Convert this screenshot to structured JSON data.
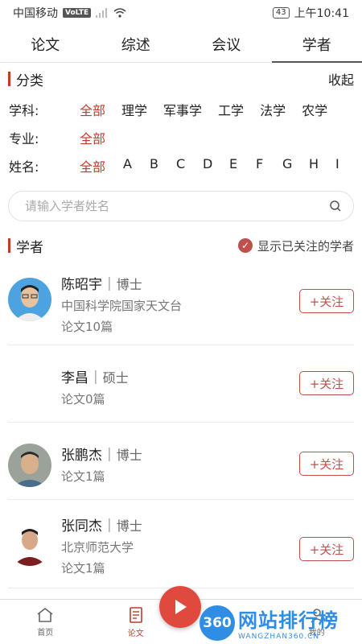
{
  "status": {
    "carrier": "中国移动",
    "volte": "VoLTE",
    "battery": "43",
    "time": "上午10:41"
  },
  "top_tabs": [
    "论文",
    "综述",
    "会议",
    "学者"
  ],
  "category": {
    "title": "分类",
    "collapse": "收起",
    "subject_label": "学科:",
    "subjects": [
      "全部",
      "理学",
      "军事学",
      "工学",
      "法学",
      "农学"
    ],
    "major_label": "专业:",
    "majors": [
      "全部"
    ],
    "name_label": "姓名:",
    "letters": [
      "全部",
      "A",
      "B",
      "C",
      "D",
      "E",
      "F",
      "G",
      "H",
      "I"
    ]
  },
  "search": {
    "placeholder": "请输入学者姓名"
  },
  "scholars_section": {
    "title": "学者",
    "show_followed": "显示已关注的学者"
  },
  "scholars": [
    {
      "name": "陈昭宇",
      "degree": "博士",
      "org": "中国科学院国家天文台",
      "papers": "论文10篇",
      "follow": "+关注",
      "has_avatar": true
    },
    {
      "name": "李昌",
      "degree": "硕士",
      "org": "",
      "papers": "论文0篇",
      "follow": "+关注",
      "has_avatar": false
    },
    {
      "name": "张鹏杰",
      "degree": "博士",
      "org": "",
      "papers": "论文1篇",
      "follow": "+关注",
      "has_avatar": true
    },
    {
      "name": "张同杰",
      "degree": "博士",
      "org": "北京师范大学",
      "papers": "论文1篇",
      "follow": "+关注",
      "has_avatar": true
    }
  ],
  "bottom_nav": [
    {
      "label": "首页",
      "icon": "home-icon"
    },
    {
      "label": "论文",
      "icon": "document-icon"
    },
    {
      "label": "",
      "icon": "play-icon"
    },
    {
      "label": "我的",
      "icon": "user-icon"
    }
  ],
  "watermark": {
    "badge": "360",
    "main": "网站排行榜",
    "sub": "WANGZHAN360.CN"
  },
  "colors": {
    "accent": "#c0392b",
    "follow": "#c0504d"
  }
}
